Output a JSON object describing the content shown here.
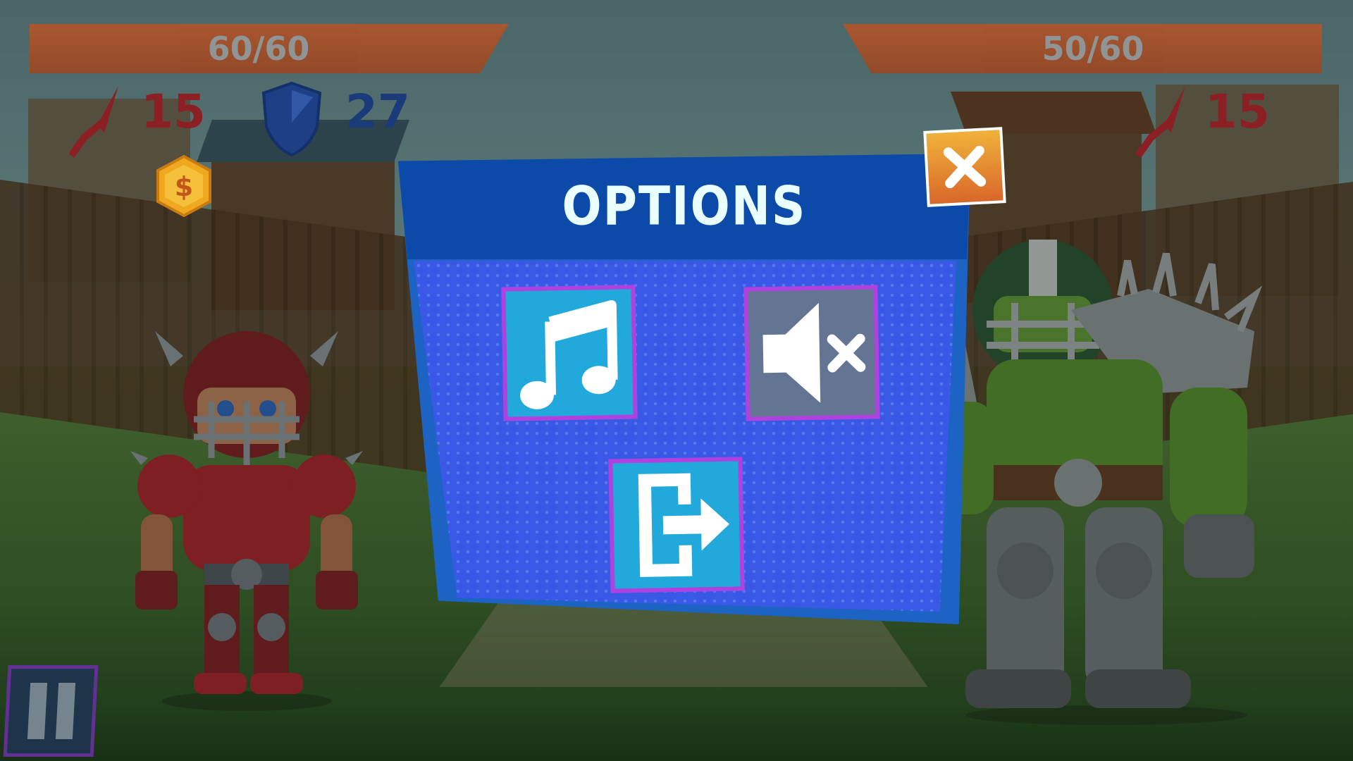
{
  "player": {
    "hp": "60/60",
    "attack": "15",
    "defense": "27"
  },
  "enemy": {
    "hp": "50/60",
    "attack": "15"
  },
  "options_modal": {
    "title": "OPTIONS",
    "music_state": "on",
    "sound_state": "muted"
  },
  "colors": {
    "hp_bar": "#b3552a",
    "attack_red": "#8c1f24",
    "defense_blue": "#1b3a7a",
    "modal_blue": "#1d63c4",
    "button_border": "#b040e0",
    "close_orange": "#e8a33d"
  },
  "icons": {
    "attack": "sword-icon",
    "defense": "shield-icon",
    "currency": "coin-icon",
    "music": "music-note-icon",
    "sound": "speaker-muted-icon",
    "exit": "exit-door-icon",
    "close": "close-icon",
    "pause": "pause-icon"
  }
}
